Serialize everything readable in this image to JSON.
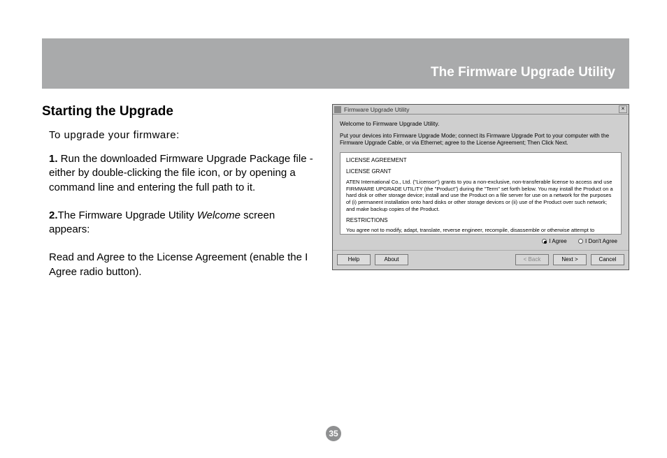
{
  "header": {
    "title": "The Firmware Upgrade Utility"
  },
  "section": {
    "title": "Starting the Upgrade",
    "intro": "To upgrade your firmware:",
    "step1_num": "1.",
    "step1_text": " Run the downloaded Firmware Upgrade Package file - either by double-clicking the file icon, or by opening a command line and entering the full path to it.",
    "step2_num": "2.",
    "step2_a": "The Firmware Upgrade Utility ",
    "step2_welcome": "Welcome",
    "step2_b": " screen appears:",
    "step2_sub_a": "Read and ",
    "step2_sub_agree": "Agree",
    "step2_sub_b": " to the License Agreement (enable the I Agree radio button)."
  },
  "dialog": {
    "titlebar": "Firmware Upgrade Utility",
    "welcome": "Welcome to Firmware Upgrade Utility.",
    "instructions": "Put your devices into Firmware Upgrade Mode; connect its Firmware Upgrade Port to your computer with the Firmware Upgrade Cable, or via Ethernet; agree to the License Agreement; Then Click Next.",
    "license_header": "LICENSE AGREEMENT",
    "license_grant": "LICENSE GRANT",
    "license_para1": "ATEN International Co., Ltd. (\"Licensor\") grants to you a non-exclusive, non-transferable license to access and use FIRMWARE UPGRADE UTILITY (the \"Product\") during the \"Term\" set forth below. You may install the Product on a hard disk or other storage device; install and use the Product on a file server for use on a network for the purposes of (i) permanent installation onto hard disks or other storage devices or (ii) use of the Product over such network; and make backup copies of the Product.",
    "license_restrictions": "RESTRICTIONS",
    "license_para2": "You agree not to modify, adapt, translate, reverse engineer, recompile, disassemble or otherwise attempt to discover the source code of the Product, or create derivative works based on the Product, or remove any proprietary notices or labels on the Product, including copyright, trademark or patent pending notices. You may not sublicense the Product or otherwise allow others to use the Product licensed to you.",
    "radio_agree": "I Agree",
    "radio_disagree": "I Don't Agree",
    "buttons": {
      "help": "Help",
      "about": "About",
      "back": "< Back",
      "next": "Next >",
      "cancel": "Cancel"
    }
  },
  "page_number": "35"
}
